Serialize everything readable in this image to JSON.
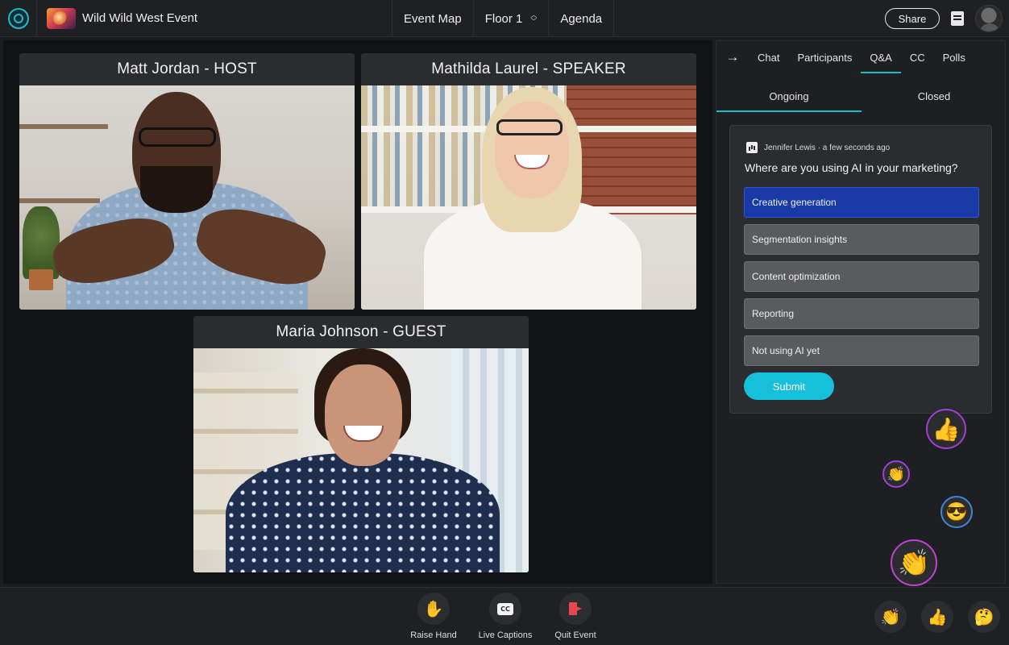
{
  "header": {
    "event_title": "Wild Wild West Event",
    "nav": [
      {
        "label": "Event Map"
      },
      {
        "label": "Floor 1"
      },
      {
        "label": "Agenda"
      }
    ],
    "share_label": "Share"
  },
  "stage": {
    "participants": [
      {
        "name": "Matt Jordan - HOST"
      },
      {
        "name": "Mathilda Laurel - SPEAKER"
      },
      {
        "name": "Maria Johnson - GUEST"
      }
    ]
  },
  "panel": {
    "collapse_icon": "arrow-right-icon",
    "tabs": [
      {
        "label": "Chat"
      },
      {
        "label": "Participants"
      },
      {
        "label": "Q&A"
      },
      {
        "label": "CC"
      },
      {
        "label": "Polls"
      }
    ],
    "active_tab": "Q&A",
    "sub_tabs": [
      {
        "label": "Ongoing"
      },
      {
        "label": "Closed"
      }
    ],
    "poll": {
      "meta": "Jennifer Lewis · a few seconds ago",
      "question": "Where are you using AI in your marketing?",
      "options": [
        {
          "label": "Creative generation",
          "selected": true
        },
        {
          "label": "Segmentation insights",
          "selected": false
        },
        {
          "label": "Content optimization",
          "selected": false
        },
        {
          "label": "Reporting",
          "selected": false
        },
        {
          "label": "Not using AI yet",
          "selected": false
        }
      ],
      "submit_label": "Submit"
    },
    "floating_reactions": [
      {
        "emoji": "👍",
        "ring": "#a23fd6"
      },
      {
        "emoji": "👏",
        "ring": "#a23fd6"
      },
      {
        "emoji": "😎",
        "ring": "#3f86d6"
      },
      {
        "emoji": "👏",
        "ring": "#c23fd6"
      }
    ]
  },
  "controls": {
    "raise_hand": {
      "label": "Raise Hand",
      "emoji": "✋"
    },
    "live_captions": {
      "label": "Live Captions",
      "glyph": "CC"
    },
    "quit_event": {
      "label": "Quit Event"
    }
  },
  "reactions": [
    {
      "emoji": "👏"
    },
    {
      "emoji": "👍"
    },
    {
      "emoji": "🤔"
    }
  ],
  "colors": {
    "accent": "#22b8c9",
    "selected_option": "#1939a6",
    "submit": "#16bfdc",
    "quit": "#e8474f"
  }
}
